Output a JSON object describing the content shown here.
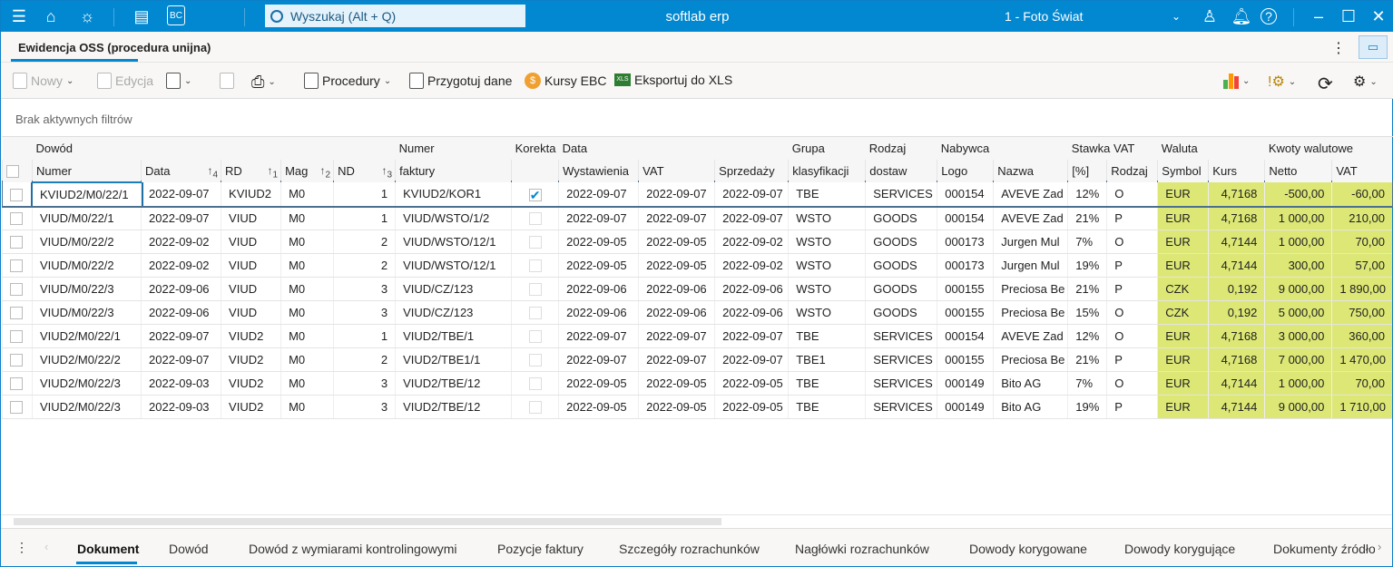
{
  "titlebar": {
    "search_placeholder": "Wyszukaj (Alt + Q)",
    "app_title": "softlab erp",
    "company": "1 - Foto Świat"
  },
  "tab": {
    "title": "Ewidencja OSS (procedura unijna)"
  },
  "toolbar": {
    "new": "Nowy",
    "edit": "Edycja",
    "procedures": "Procedury",
    "prepare": "Przygotuj dane",
    "rates": "Kursy EBC",
    "export": "Eksportuj do XLS"
  },
  "filters": "Brak aktywnych filtrów",
  "grid": {
    "group_headers": {
      "dowod": "Dowód",
      "numer": "Numer",
      "korekta": "Korekta",
      "data": "Data",
      "grupa": "Grupa",
      "rodzaj": "Rodzaj",
      "nabywca": "Nabywca",
      "stawka": "Stawka VAT",
      "waluta": "Waluta",
      "kwoty": "Kwoty walutowe"
    },
    "columns": [
      "Numer",
      "Data",
      "RD",
      "Mag",
      "ND",
      "faktury",
      "",
      "Wystawienia",
      "VAT",
      "Sprzedaży",
      "klasyfikacji",
      "dostaw",
      "Logo",
      "Nazwa",
      "[%]",
      "Rodzaj",
      "Symbol",
      "Kurs",
      "Netto",
      "VAT"
    ],
    "sort_orders": {
      "data": "4",
      "rd": "1",
      "mag": "2",
      "nd": "3"
    },
    "rows": [
      [
        "KVIUD2/M0/22/1",
        "2022-09-07",
        "KVIUD2",
        "M0",
        "1",
        "KVIUD2/KOR1",
        true,
        "2022-09-07",
        "2022-09-07",
        "2022-09-07",
        "TBE",
        "SERVICES",
        "000154",
        "AVEVE Zad",
        "12%",
        "O",
        "EUR",
        "4,7168",
        "-500,00",
        "-60,00"
      ],
      [
        "VIUD/M0/22/1",
        "2022-09-07",
        "VIUD",
        "M0",
        "1",
        "VIUD/WSTO/1/2",
        false,
        "2022-09-07",
        "2022-09-07",
        "2022-09-07",
        "WSTO",
        "GOODS",
        "000154",
        "AVEVE Zad",
        "21%",
        "P",
        "EUR",
        "4,7168",
        "1 000,00",
        "210,00"
      ],
      [
        "VIUD/M0/22/2",
        "2022-09-02",
        "VIUD",
        "M0",
        "2",
        "VIUD/WSTO/12/1",
        false,
        "2022-09-05",
        "2022-09-05",
        "2022-09-02",
        "WSTO",
        "GOODS",
        "000173",
        "Jurgen Mul",
        "7%",
        "O",
        "EUR",
        "4,7144",
        "1 000,00",
        "70,00"
      ],
      [
        "VIUD/M0/22/2",
        "2022-09-02",
        "VIUD",
        "M0",
        "2",
        "VIUD/WSTO/12/1",
        false,
        "2022-09-05",
        "2022-09-05",
        "2022-09-02",
        "WSTO",
        "GOODS",
        "000173",
        "Jurgen Mul",
        "19%",
        "P",
        "EUR",
        "4,7144",
        "300,00",
        "57,00"
      ],
      [
        "VIUD/M0/22/3",
        "2022-09-06",
        "VIUD",
        "M0",
        "3",
        "VIUD/CZ/123",
        false,
        "2022-09-06",
        "2022-09-06",
        "2022-09-06",
        "WSTO",
        "GOODS",
        "000155",
        "Preciosa Be",
        "21%",
        "P",
        "CZK",
        "0,192",
        "9 000,00",
        "1 890,00"
      ],
      [
        "VIUD/M0/22/3",
        "2022-09-06",
        "VIUD",
        "M0",
        "3",
        "VIUD/CZ/123",
        false,
        "2022-09-06",
        "2022-09-06",
        "2022-09-06",
        "WSTO",
        "GOODS",
        "000155",
        "Preciosa Be",
        "15%",
        "O",
        "CZK",
        "0,192",
        "5 000,00",
        "750,00"
      ],
      [
        "VIUD2/M0/22/1",
        "2022-09-07",
        "VIUD2",
        "M0",
        "1",
        "VIUD2/TBE/1",
        false,
        "2022-09-07",
        "2022-09-07",
        "2022-09-07",
        "TBE",
        "SERVICES",
        "000154",
        "AVEVE Zad",
        "12%",
        "O",
        "EUR",
        "4,7168",
        "3 000,00",
        "360,00"
      ],
      [
        "VIUD2/M0/22/2",
        "2022-09-07",
        "VIUD2",
        "M0",
        "2",
        "VIUD2/TBE1/1",
        false,
        "2022-09-07",
        "2022-09-07",
        "2022-09-07",
        "TBE1",
        "SERVICES",
        "000155",
        "Preciosa Be",
        "21%",
        "P",
        "EUR",
        "4,7168",
        "7 000,00",
        "1 470,00"
      ],
      [
        "VIUD2/M0/22/3",
        "2022-09-03",
        "VIUD2",
        "M0",
        "3",
        "VIUD2/TBE/12",
        false,
        "2022-09-05",
        "2022-09-05",
        "2022-09-05",
        "TBE",
        "SERVICES",
        "000149",
        "Bito AG",
        "7%",
        "O",
        "EUR",
        "4,7144",
        "1 000,00",
        "70,00"
      ],
      [
        "VIUD2/M0/22/3",
        "2022-09-03",
        "VIUD2",
        "M0",
        "3",
        "VIUD2/TBE/12",
        false,
        "2022-09-05",
        "2022-09-05",
        "2022-09-05",
        "TBE",
        "SERVICES",
        "000149",
        "Bito AG",
        "19%",
        "P",
        "EUR",
        "4,7144",
        "9 000,00",
        "1 710,00"
      ]
    ]
  },
  "bottom_tabs": [
    "Dokument",
    "Dowód",
    "Dowód z wymiarami kontrolingowymi",
    "Pozycje faktury",
    "Szczegóły rozrachunków",
    "Nagłówki rozrachunków",
    "Dowody korygowane",
    "Dowody korygujące",
    "Dokumenty źródłowe"
  ],
  "colors": {
    "accent": "#0288d1",
    "highlight": "#dce775"
  }
}
